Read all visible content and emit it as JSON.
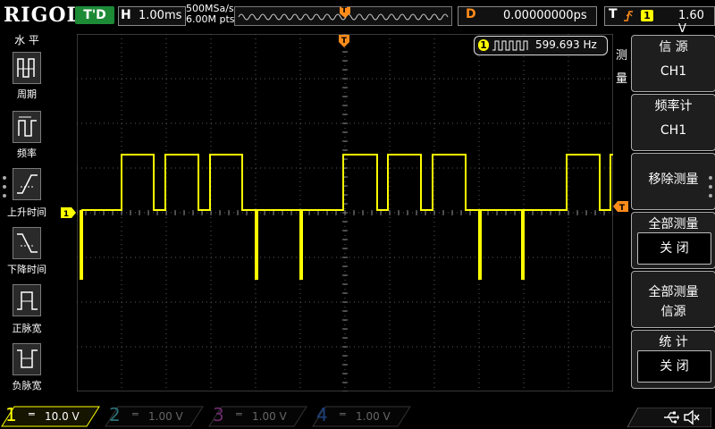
{
  "brand": "RIGOL",
  "header": {
    "trigger_status": "T'D",
    "horizontal_key": "H",
    "timebase": "1.00ms",
    "sample_rate": "500MSa/s",
    "memory_depth": "6.00M pts",
    "trigger_marker": "T",
    "delay_key": "D",
    "delay_value": "0.00000000ps",
    "trigger_key": "T",
    "trigger_source": "1",
    "trigger_level": "1.60 V"
  },
  "left_menu": {
    "title": "水 平",
    "items": [
      {
        "label": "周期",
        "icon": "period-icon"
      },
      {
        "label": "频率",
        "icon": "frequency-icon"
      },
      {
        "label": "上升时间",
        "icon": "rise-time-icon"
      },
      {
        "label": "下降时间",
        "icon": "fall-time-icon"
      },
      {
        "label": "正脉宽",
        "icon": "positive-pulse-width-icon"
      },
      {
        "label": "负脉宽",
        "icon": "negative-pulse-width-icon"
      }
    ]
  },
  "measurement_readout": {
    "channel": "1",
    "value": "599.693 Hz",
    "icon": "square-wave-icon"
  },
  "channel_marker": "1",
  "trigger_level_marker": "T",
  "right_menu": {
    "tab_label": "测量",
    "source_title": "信 源",
    "source_value": "CH1",
    "counter_title": "频率计",
    "counter_value": "CH1",
    "remove_label": "移除测量",
    "all_measure_title": "全部测量",
    "all_measure_value": "关 闭",
    "all_source_title_line1": "全部测量",
    "all_source_title_line2": "信源",
    "stats_title": "统 计",
    "stats_value": "关 闭"
  },
  "bottom": {
    "channels": [
      {
        "num": "1",
        "scale": "10.0 V",
        "color": "#ffff00",
        "active": true
      },
      {
        "num": "2",
        "scale": "1.00 V",
        "color": "#00c8d8",
        "active": false
      },
      {
        "num": "3",
        "scale": "1.00 V",
        "color": "#d040d0",
        "active": false
      },
      {
        "num": "4",
        "scale": "1.00 V",
        "color": "#2080ff",
        "active": false
      }
    ],
    "usb_icon": "usb-icon",
    "speaker_icon": "speaker-muted-icon"
  },
  "colors": {
    "ch1": "#ffff00",
    "trigger": "#ff8c1a",
    "grid": "#5a5a5a",
    "status_green": "#1d8a36"
  }
}
